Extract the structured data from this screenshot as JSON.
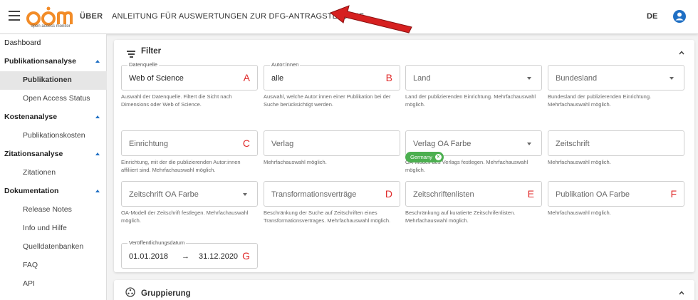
{
  "header": {
    "logo_text": "oam",
    "logo_subtitle": "open access monitor",
    "nav_about": "ÜBER",
    "title": "ANLEITUNG FÜR AUSWERTUNGEN ZUR DFG-ANTRAGSTELLUNG",
    "language": "DE"
  },
  "sidebar": {
    "dashboard": "Dashboard",
    "sections": [
      {
        "label": "Publikationsanalyse",
        "items": [
          "Publikationen",
          "Open Access Status"
        ]
      },
      {
        "label": "Kostenanalyse",
        "items": [
          "Publikationskosten"
        ]
      },
      {
        "label": "Zitationsanalyse",
        "items": [
          "Zitationen"
        ]
      },
      {
        "label": "Dokumentation",
        "items": [
          "Release Notes",
          "Info und Hilfe",
          "Quelldatenbanken",
          "FAQ",
          "API"
        ]
      }
    ]
  },
  "filter": {
    "title": "Filter",
    "fields": {
      "datenquelle": {
        "legend": "Datenquelle",
        "value": "Web of Science",
        "letter": "A",
        "hint": "Auswahl der Datenquelle. Filtert die Sicht nach Dimensions oder Web of Science."
      },
      "autoren": {
        "legend": "Autor:innen",
        "value": "alle",
        "letter": "B",
        "hint": "Auswahl, welche Autor:innen einer Publikation bei der Suche berücksichtigt werden."
      },
      "land": {
        "label": "Land",
        "hint": "Land der publizierenden Einrichtung. Mehrfachauswahl möglich.",
        "chip": "Germany"
      },
      "bundesland": {
        "label": "Bundesland",
        "hint": "Bundesland der publizierenden Einrichtung. Mehrfachauswahl möglich."
      },
      "einrichtung": {
        "label": "Einrichtung",
        "letter": "C",
        "hint": "Einrichtung, mit der die publizierenden Autor:innen affiliiert sind. Mehrfachauswahl möglich."
      },
      "verlag": {
        "label": "Verlag",
        "hint": "Mehrfachauswahl möglich."
      },
      "verlag_oa": {
        "label": "Verlag OA Farbe",
        "hint": "OA-Modell des Verlags festlegen. Mehrfachauswahl möglich."
      },
      "zeitschrift": {
        "label": "Zeitschrift",
        "hint": "Mehrfachauswahl möglich."
      },
      "zeitschrift_oa": {
        "label": "Zeitschrift OA Farbe",
        "hint": "OA-Modell der Zeitschrift festlegen. Mehrfachauswahl möglich."
      },
      "transformation": {
        "label": "Transformationsverträge",
        "letter": "D",
        "hint": "Beschränkung der Suche auf Zeitschriften eines Transformationsvertrages. Mehrfachauswahl möglich."
      },
      "zeitschriftenlisten": {
        "label": "Zeitschriftenlisten",
        "letter": "E",
        "hint": "Beschränkung auf kuratierte Zeitschrifenlisten. Mehrfachauswahl möglich."
      },
      "publikation_oa": {
        "label": "Publikation OA Farbe",
        "letter": "F",
        "hint": "Mehrfachauswahl möglich."
      },
      "datum": {
        "legend": "Veröffentlichungsdatum",
        "from": "01.01.2018",
        "arrow": "→",
        "to": "31.12.2020",
        "letter": "G"
      }
    }
  },
  "grouping": {
    "title": "Gruppierung"
  },
  "colors": {
    "accent": "#1f6fc4",
    "logo_orange": "#f28c28",
    "annotation_red": "#e02a2a",
    "chip_green": "#4caf50"
  }
}
